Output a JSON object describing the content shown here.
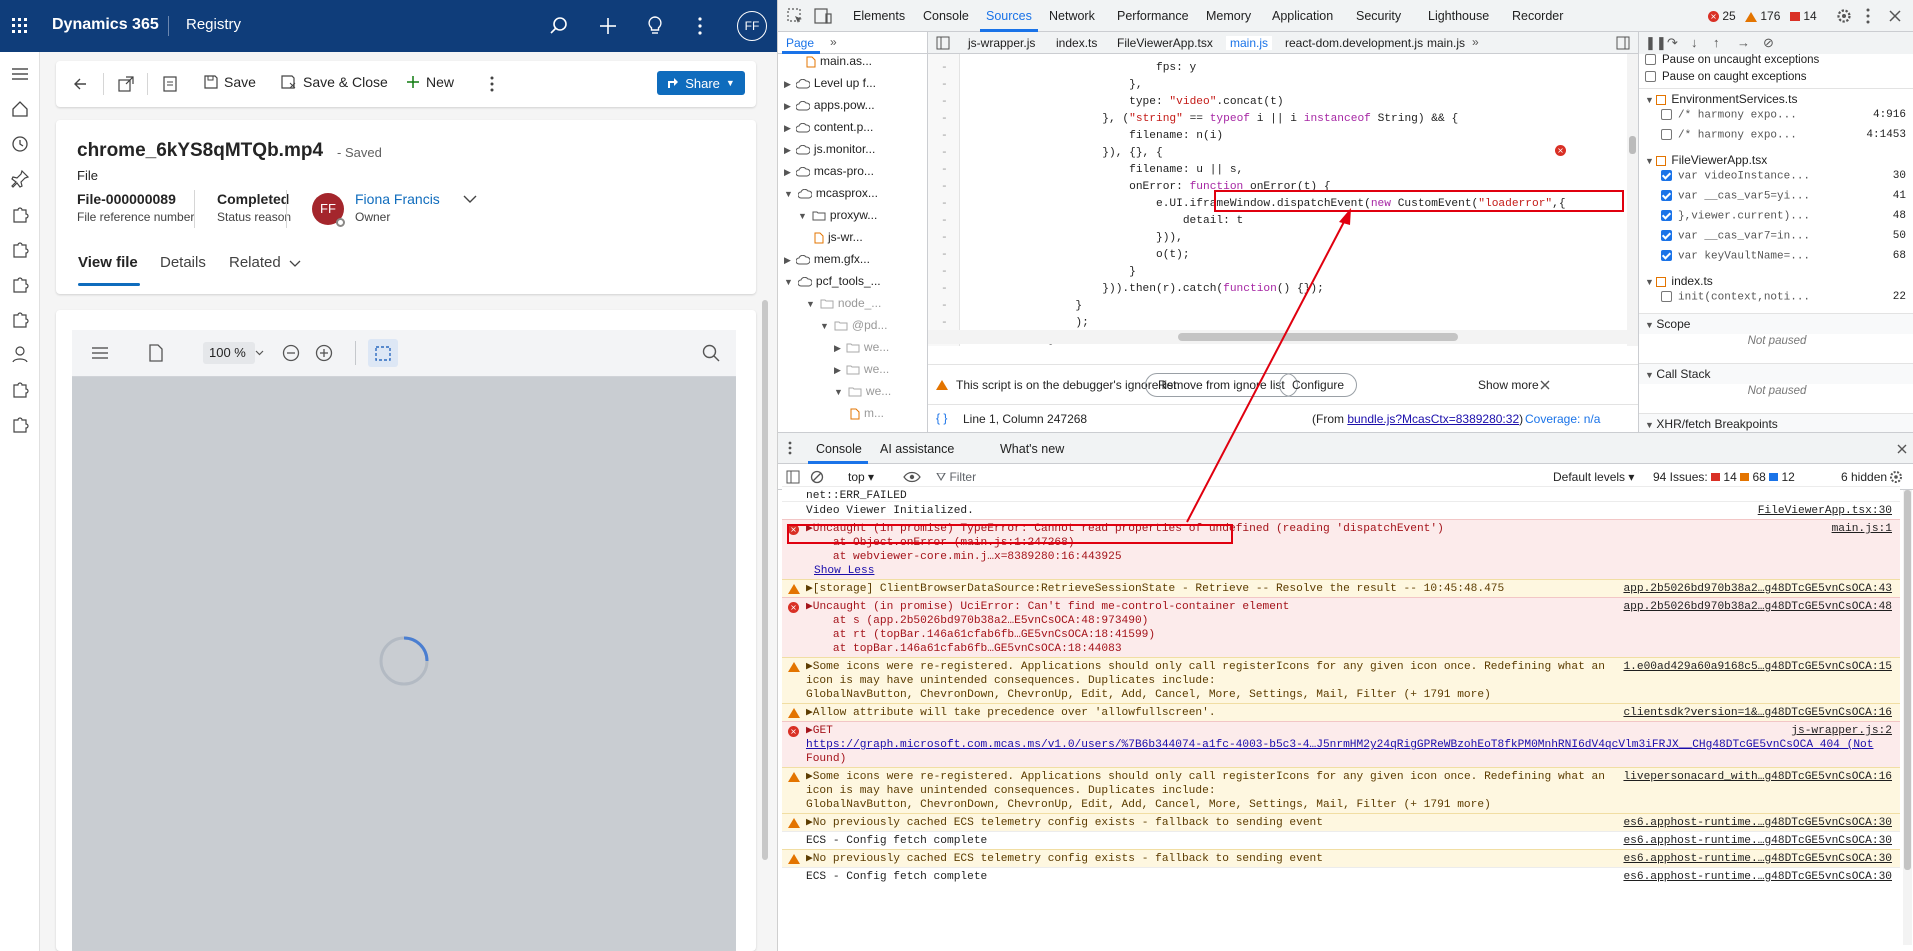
{
  "d365": {
    "app": "Dynamics 365",
    "area": "Registry",
    "avatar": "FF",
    "cmd": {
      "save": "Save",
      "save_close": "Save & Close",
      "new": "New",
      "share": "Share"
    },
    "record": {
      "title": "chrome_6kYS8qMTQb.mp4",
      "saved": "- Saved",
      "entity": "File",
      "ref_value": "File-000000089",
      "ref_label": "File reference number",
      "status_value": "Completed",
      "status_label": "Status reason",
      "owner_initials": "FF",
      "owner_name": "Fiona Francis",
      "owner_label": "Owner"
    },
    "tabs": [
      "View file",
      "Details",
      "Related"
    ],
    "viewer": {
      "zoom": "100 %"
    }
  },
  "devtools": {
    "tabs": [
      "Elements",
      "Console",
      "Sources",
      "Network",
      "Performance",
      "Memory",
      "Application",
      "Security",
      "Lighthouse",
      "Recorder"
    ],
    "counts": {
      "errors": "25",
      "warnings": "176",
      "issues": "14"
    },
    "nav": {
      "page": "Page"
    },
    "tree": [
      "main.as...",
      "Level up f...",
      "apps.pow...",
      "content.p...",
      "js.monitor...",
      "mcas-pro...",
      "mcasprox...",
      "proxyw...",
      "js-wr...",
      "mem.gfx...",
      "pcf_tools_...",
      "node_...",
      "@pd...",
      "we...",
      "we...",
      "we...",
      "m..."
    ],
    "filetabs": [
      "js-wrapper.js",
      "index.ts",
      "FileViewerApp.tsx",
      "main.js",
      "react-dom.development.js",
      "main.js"
    ],
    "code": [
      {
        "t": "                            fps: y"
      },
      {
        "t": "                        },"
      },
      {
        "t": "                        type: \"video\".concat(t)"
      },
      {
        "t": "                    }, (\"string\" == typeof i || i instanceof String) && {"
      },
      {
        "t": "                        filename: n(i)"
      },
      {
        "t": "                    }), {}, {"
      },
      {
        "t": "                        filename: u || s,"
      },
      {
        "t": "                        onError: function onError(t) {"
      },
      {
        "t": "                            e.UI.iframeWindow.dispatchEvent(new CustomEvent(\"loaderror\",{"
      },
      {
        "t": "                                detail: t"
      },
      {
        "t": "                            })),"
      },
      {
        "t": "                            o(t);"
      },
      {
        "t": "                        }"
      },
      {
        "t": "                    })).then(r).catch(function() {});"
      },
      {
        "t": "                }"
      },
      {
        "t": "                );"
      },
      {
        "t": "            }"
      }
    ],
    "ignore": {
      "msg": "This script is on the debugger's ignore list",
      "remove": "Remove from ignore list",
      "configure": "Configure",
      "show_more": "Show more"
    },
    "status": {
      "pos": "Line 1, Column 247268",
      "from": "(From ",
      "from_link": "bundle.js?McasCtx=8389280:32",
      "from_end": ")",
      "coverage": "Coverage: n/a"
    },
    "right": {
      "pause_uncaught": "Pause on uncaught exceptions",
      "pause_caught": "Pause on caught exceptions",
      "g1": "EnvironmentServices.ts",
      "g1items": [
        {
          "t": "/* harmony expo...",
          "n": "4:916"
        },
        {
          "t": "/* harmony expo...",
          "n": "4:1453"
        }
      ],
      "g2": "FileViewerApp.tsx",
      "g2items": [
        {
          "t": "var videoInstance...",
          "n": "30"
        },
        {
          "t": "var __cas_var5=yi...",
          "n": "41"
        },
        {
          "t": "},viewer.current)...",
          "n": "48"
        },
        {
          "t": "var __cas_var7=in...",
          "n": "50"
        },
        {
          "t": "var keyVaultName=...",
          "n": "68"
        }
      ],
      "g3": "index.ts",
      "g3items": [
        {
          "t": "init(context,noti...",
          "n": "22"
        }
      ],
      "scope": "Scope",
      "not_paused": "Not paused",
      "call_stack": "Call Stack",
      "not_paused2": "Not paused",
      "xhr": "XHR/fetch Breakpoints"
    },
    "drawer": {
      "tabs": [
        "Console",
        "AI assistance",
        "What's new"
      ],
      "ctx": "top",
      "filter": "Filter",
      "levels": "Default levels",
      "issues": "94 Issues:",
      "ie": "14",
      "iw": "68",
      "ii": "12",
      "hidden": "6 hidden"
    },
    "console": [
      {
        "k": "plain",
        "lines": [
          "net::ERR_FAILED"
        ],
        "src": ""
      },
      {
        "k": "plain",
        "lines": [
          "Video Viewer Initialized."
        ],
        "src": "FileViewerApp.tsx:30"
      },
      {
        "k": "err",
        "lines": [
          "▶Uncaught (in promise) TypeError: Cannot read properties of undefined (reading 'dispatchEvent')",
          "    at Object.onError (main.js:1:247268)",
          "    at webviewer-core.min.j…x=8389280:16:443925",
          "Show Less"
        ],
        "src": "main.js:1"
      },
      {
        "k": "warn",
        "lines": [
          "▶[storage] ClientBrowserDataSource:RetrieveSessionState - Retrieve -- Resolve the result -- 10:45:48.475"
        ],
        "src": "app.2b5026bd970b38a2…g48DTcGE5vnCsOCA:43"
      },
      {
        "k": "err",
        "lines": [
          "▶Uncaught (in promise) UciError: Can't find me-control-container element",
          "    at s (app.2b5026bd970b38a2…E5vnCsOCA:48:973490)",
          "    at rt (topBar.146a61cfab6fb…GE5vnCsOCA:18:41599)",
          "    at topBar.146a61cfab6fb…GE5vnCsOCA:18:44083"
        ],
        "src": "app.2b5026bd970b38a2…g48DTcGE5vnCsOCA:48"
      },
      {
        "k": "warn",
        "lines": [
          "▶Some icons were re-registered. Applications should only call registerIcons for any given icon once. Redefining what an",
          "icon is may have unintended consequences. Duplicates include:",
          "GlobalNavButton, ChevronDown, ChevronUp, Edit, Add, Cancel, More, Settings, Mail, Filter (+ 1791 more)"
        ],
        "src": "1.e00ad429a60a9168c5…g48DTcGE5vnCsOCA:15"
      },
      {
        "k": "warn",
        "lines": [
          "▶Allow attribute will take precedence over 'allowfullscreen'."
        ],
        "src": "clientsdk?version=1&…g48DTcGE5vnCsOCA:16"
      },
      {
        "k": "err",
        "lines": [
          "▶GET",
          "https://graph.microsoft.com.mcas.ms/v1.0/users/%7B6b344074-a1fc-4003-b5c3-4…J5nrmHM2y24qRigGPReWBzohEoT8fkPM0MnhRNI6dV4qcVlm3iFRJX__CHg48DTcGE5vnCsOCA 404 (Not",
          "Found)"
        ],
        "src": "js-wrapper.js:2"
      },
      {
        "k": "warn",
        "lines": [
          "▶Some icons were re-registered. Applications should only call registerIcons for any given icon once. Redefining what an",
          "icon is may have unintended consequences. Duplicates include:",
          "GlobalNavButton, ChevronDown, ChevronUp, Edit, Add, Cancel, More, Settings, Mail, Filter (+ 1791 more)"
        ],
        "src": "livepersonacard_with…g48DTcGE5vnCsOCA:16"
      },
      {
        "k": "warn",
        "lines": [
          "▶No previously cached ECS telemetry config exists - fallback to sending event"
        ],
        "src": "es6.apphost-runtime.…g48DTcGE5vnCsOCA:30"
      },
      {
        "k": "plain",
        "lines": [
          "ECS - Config fetch complete"
        ],
        "src": "es6.apphost-runtime.…g48DTcGE5vnCsOCA:30"
      },
      {
        "k": "warn",
        "lines": [
          "▶No previously cached ECS telemetry config exists - fallback to sending event"
        ],
        "src": "es6.apphost-runtime.…g48DTcGE5vnCsOCA:30"
      },
      {
        "k": "plain",
        "lines": [
          "ECS - Config fetch complete"
        ],
        "src": "es6.apphost-runtime.…g48DTcGE5vnCsOCA:30"
      }
    ]
  }
}
